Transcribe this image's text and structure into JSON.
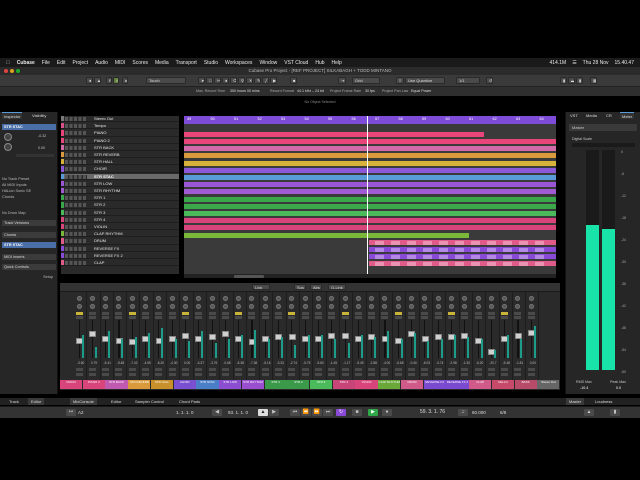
{
  "menubar": {
    "items": [
      "Cubase",
      "File",
      "Edit",
      "Project",
      "Audio",
      "MIDI",
      "Scores",
      "Media",
      "Transport",
      "Studio",
      "Workspaces",
      "Window",
      "VST Cloud",
      "Hub",
      "Help"
    ],
    "status": [
      "414.1M",
      "Thu 28 Nov",
      "15.40.47"
    ]
  },
  "window": {
    "title": "Cubase Pro Project - [REF PROJECT] SILKABAGH + TODD MINTANO"
  },
  "toolbar": {
    "touch_mode": "Touch",
    "grid": "Grid",
    "quantize": "Use Quantize",
    "quantize_value": "1/1"
  },
  "infoline": {
    "max_record_time": "Max. Record Time",
    "max_record_value": "350 hours 00 mins",
    "record_format": "Record Format",
    "record_format_value": "44.1 kHz – 24 bit",
    "frame_rate": "Project Frame Rate",
    "frame_rate_value": "30 fps",
    "pan_law": "Project Pan Law",
    "pan_law_value": "Equal Power"
  },
  "arrange_status": "No Object Selected",
  "inspector": {
    "tabs": [
      "Inspector",
      "Visibility"
    ],
    "track_name": "STR STAC",
    "rows": [
      "No Track Preset",
      "All MIDI Inputs",
      "HALion Sonic SE",
      "Chords",
      "No Drum Map",
      "Track Versions",
      "Chords"
    ],
    "sections": [
      "MIDI Inserts",
      "Quick Controls",
      "Setup"
    ],
    "second_track": "STR STAC",
    "params": [
      "-0.32",
      "0.00"
    ]
  },
  "tracks": [
    {
      "name": "Stereo Out",
      "color": "#7a7a7a"
    },
    {
      "name": "Tempo",
      "color": "#d94f8a"
    },
    {
      "name": "PIANO",
      "color": "#e8457a"
    },
    {
      "name": "PIANO 2",
      "color": "#e8457a"
    },
    {
      "name": "STR BACK",
      "color": "#d26aaa"
    },
    {
      "name": "STR REVERB",
      "color": "#d89a3a"
    },
    {
      "name": "STR HALL",
      "color": "#d8b13a"
    },
    {
      "name": "CHOIR",
      "color": "#8b58d8"
    },
    {
      "name": "STR STAC",
      "color": "#5a9ad8"
    },
    {
      "name": "STR LOW",
      "color": "#9b56d6"
    },
    {
      "name": "STR RHYTHM",
      "color": "#a05ad4"
    },
    {
      "name": "STR 1",
      "color": "#3aa84a"
    },
    {
      "name": "STR 2",
      "color": "#3aa84a"
    },
    {
      "name": "STR 3",
      "color": "#4aba5a"
    },
    {
      "name": "STR 4",
      "color": "#d8457a"
    },
    {
      "name": "VIOLIN",
      "color": "#d8457a"
    },
    {
      "name": "CLAP RHYTHM",
      "color": "#7ab83a"
    },
    {
      "name": "DRUM",
      "color": "#e05a8a"
    },
    {
      "name": "REVERSE FX",
      "color": "#8a4ad8"
    },
    {
      "name": "REVERSE FX 2",
      "color": "#8a4ad8"
    },
    {
      "name": "CLAP",
      "color": "#e05a8a"
    }
  ],
  "ruler": {
    "bars": [
      "49",
      "50",
      "51",
      "52",
      "53",
      "54",
      "55",
      "56",
      "57",
      "58",
      "59",
      "60",
      "61",
      "62",
      "63",
      "64"
    ]
  },
  "mixer": {
    "toolbar": [
      "Link",
      "Sus",
      "Abs",
      "Q-Link"
    ],
    "values": [
      "-3.60",
      "0.79",
      "-5.41",
      "-5.48",
      "-7.42",
      "-4.55",
      "-6.20",
      "-4.30",
      "0.00",
      "-4.37",
      "-3.76",
      "-0.68",
      "-5.38",
      "-7.38",
      "-5.16",
      "-3.33",
      "-2.74",
      "-5.75",
      "-5.60",
      "-1.45",
      "-1.17",
      "-5.45",
      "-2.88",
      "-4.00",
      "-6.68",
      "-0.40",
      "-6.03",
      "-3.74",
      "-2.98",
      "-1.30",
      "-6.20",
      "-20.7",
      "-5.48",
      "-1.81",
      "0.00"
    ],
    "channels": [
      {
        "name": "PIANO",
        "color": "#d8457a"
      },
      {
        "name": "PIANO 2",
        "color": "#d8457a"
      },
      {
        "name": "STR BACK",
        "color": "#c05ab0"
      },
      {
        "name": "STR REVERB",
        "color": "#d89a3a"
      },
      {
        "name": "STR HALL",
        "color": "#c8902a"
      },
      {
        "name": "CHOIR",
        "color": "#7a50d0"
      },
      {
        "name": "STR STAC",
        "color": "#4a7fc8"
      },
      {
        "name": "STR LOW",
        "color": "#8b4ed0"
      },
      {
        "name": "STR RHYTHM",
        "color": "#9a4ed0"
      },
      {
        "name": "STR 1",
        "color": "#3a9a4a"
      },
      {
        "name": "STR 2",
        "color": "#3a9a4a"
      },
      {
        "name": "STR 3",
        "color": "#4aba5a"
      },
      {
        "name": "STR 4",
        "color": "#c8457a"
      },
      {
        "name": "VIOLIN",
        "color": "#d8457a"
      },
      {
        "name": "CLAP RHYTHM",
        "color": "#6aa83a"
      },
      {
        "name": "DRUM",
        "color": "#d05a8a"
      },
      {
        "name": "REVERSE FX",
        "color": "#7a4ad0"
      },
      {
        "name": "REVERSE FX 2",
        "color": "#7a4ad0"
      },
      {
        "name": "CLAP",
        "color": "#d05a8a"
      },
      {
        "name": "CELLO",
        "color": "#c84a6a"
      },
      {
        "name": "BASS",
        "color": "#b84a6a"
      },
      {
        "name": "Stereo Out",
        "color": "#666666"
      }
    ]
  },
  "lowertabs": [
    "Track",
    "Editor",
    "MixConsole",
    "Editor",
    "Sampler Control",
    "Chord Pads",
    "Master",
    "Loudness"
  ],
  "transport": {
    "left_locator": "1. 1. 1. 0",
    "right_locator": "93. 1. 1. 0",
    "position": "59. 3. 1. 76",
    "tempo": "60.000",
    "signature": "6/8",
    "punch": "A2"
  },
  "rightzone": {
    "tabs": [
      "VST",
      "Media",
      "CR",
      "Meter"
    ],
    "title": "Master",
    "subtitle": "Digital Scale",
    "scale": [
      "0",
      "-6",
      "-12",
      "-18",
      "-24",
      "-30",
      "-36",
      "-42",
      "-48",
      "-54",
      "-60"
    ],
    "rms_label": "RMS Max",
    "rms_value": "-10.4",
    "peak_label": "Peak Max",
    "peak_value": "0.0",
    "meter_fill": [
      0.66,
      0.64
    ]
  }
}
